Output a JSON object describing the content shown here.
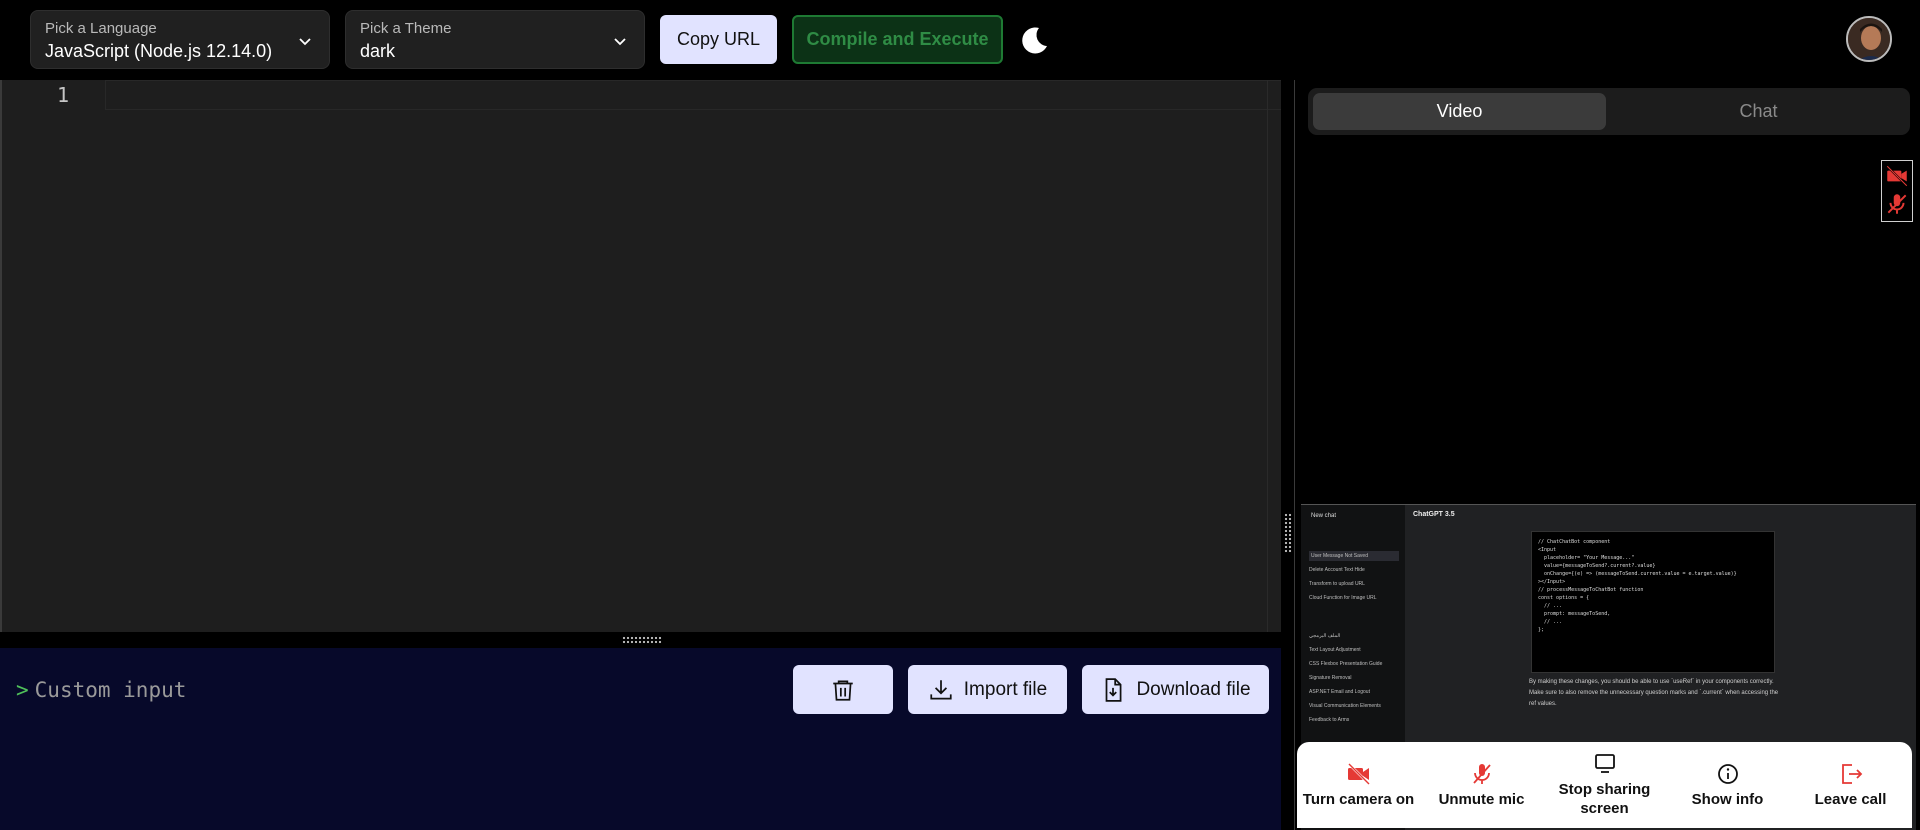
{
  "topbar": {
    "language": {
      "label": "Pick a Language",
      "value": "JavaScript (Node.js 12.14.0)"
    },
    "theme": {
      "label": "Pick a Theme",
      "value": "dark"
    },
    "copy_url_label": "Copy URL",
    "compile_label": "Compile and Execute",
    "icons": {
      "theme_toggle": "moon-icon",
      "user": "avatar"
    }
  },
  "editor": {
    "line_numbers": [
      "1"
    ]
  },
  "input_panel": {
    "prompt_symbol": ">",
    "placeholder": "Custom input",
    "import_label": "Import file",
    "download_label": "Download file"
  },
  "right_panel": {
    "tabs": [
      {
        "label": "Video",
        "active": true
      },
      {
        "label": "Chat",
        "active": false
      }
    ],
    "shared_screen": {
      "new_chat": "New chat",
      "app_title": "ChatGPT 3.5",
      "history": [
        "User Message Not Saved",
        "Delete Account Text Hide",
        "Transform to upload URL",
        "Cloud Function for Image URL",
        "الملف البرمجي",
        "Text Layout Adjustment",
        "CSS Flexbox Presentation Guide",
        "Signature Removal",
        "ASP.NET Email and Logout",
        "Visual Communication Elements",
        "Feedback to Arms"
      ],
      "code_lines": [
        "// ChatChatBot component",
        "<Input",
        "  placeholder= \"Your Message...\"",
        "  value={messageToSend?.current?.value}",
        "  onChange={(e) => (messageToSend.current.value = e.target.value)}",
        "></Input>",
        "",
        "// processMessageToChatBot function",
        "const options = {",
        "  // ...",
        "  prompt: messageToSend,",
        "  // ...",
        "};"
      ],
      "paragraph": "By making these changes, you should be able to use `useRef` in your components correctly. Make sure to also remove the unnecessary question marks and `.current` when accessing the ref values."
    },
    "controls": [
      {
        "label": "Turn camera on",
        "icon": "camera-off-icon",
        "color": "#e53935"
      },
      {
        "label": "Unmute mic",
        "icon": "mic-off-icon",
        "color": "#e53935"
      },
      {
        "label": "Stop sharing screen",
        "icon": "screen-share-icon",
        "color": "#111111"
      },
      {
        "label": "Show info",
        "icon": "info-icon",
        "color": "#111111"
      },
      {
        "label": "Leave call",
        "icon": "leave-call-icon",
        "color": "#e53935"
      }
    ]
  },
  "colors": {
    "accent_button": "#e1e3ff",
    "compile_green": "#2f8c45",
    "danger": "#e53935",
    "input_bg": "#07092a"
  }
}
